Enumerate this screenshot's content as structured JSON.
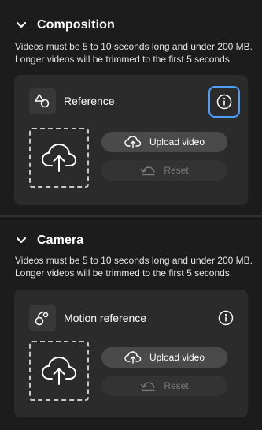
{
  "sections": [
    {
      "title": "Composition",
      "description": "Videos must be 5 to 10 seconds long and under 200 MB. Longer videos will be trimmed to the first 5 seconds.",
      "card": {
        "title": "Reference",
        "type_icon": "shapes-icon",
        "info_icon": "info-icon",
        "upload_label": "Upload video",
        "reset_label": "Reset"
      }
    },
    {
      "title": "Camera",
      "description": "Videos must be 5 to 10 seconds long and under 200 MB. Longer videos will be trimmed to the first 5 seconds.",
      "card": {
        "title": "Motion reference",
        "type_icon": "motion-icon",
        "info_icon": "info-icon",
        "upload_label": "Upload video",
        "reset_label": "Reset"
      }
    }
  ],
  "colors": {
    "background": "#1c1c1c",
    "card": "#2b2b2b",
    "focus_ring": "#4a9fff",
    "button": "#4a4a4a",
    "button_disabled": "#333333"
  }
}
